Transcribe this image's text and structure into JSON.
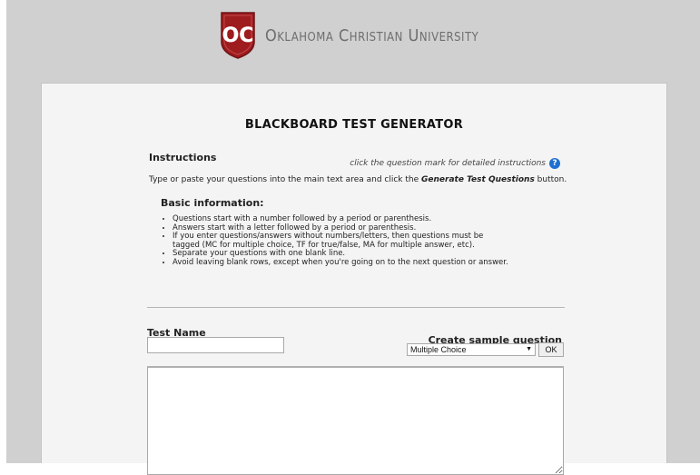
{
  "header": {
    "logo_initials": "OC",
    "university_name": "Oklahoma Christian University",
    "logo_color": "#9e1b1e"
  },
  "page": {
    "title": "BLACKBOARD TEST GENERATOR"
  },
  "instructions": {
    "heading": "Instructions",
    "help_hint": "click the question mark for detailed instructions",
    "help_icon": "question-circle-icon",
    "help_icon_glyph": "?",
    "intro_before": "Type or paste your questions into the main text area and click the ",
    "intro_button_name": "Generate Test Questions",
    "intro_after": " button."
  },
  "basic_info": {
    "heading": "Basic information:",
    "items": [
      "Questions start with a number followed by a period or parenthesis.",
      "Answers start with a letter followed by a period or parenthesis.",
      "If you enter questions/answers without numbers/letters, then questions must be tagged (MC for multiple choice, TF for true/false, MA for multiple answer, etc).",
      "Separate your questions with one blank line.",
      "Avoid leaving blank rows, except when you're going on to the next question or answer."
    ]
  },
  "form": {
    "test_name_label": "Test Name",
    "test_name_value": "",
    "sample_label": "Create sample question",
    "sample_selected": "Multiple Choice",
    "ok_label": "OK",
    "textarea_value": ""
  },
  "colors": {
    "backdrop": "#d0d0d0",
    "card": "#f4f4f4",
    "help_icon": "#1e6fd1"
  }
}
